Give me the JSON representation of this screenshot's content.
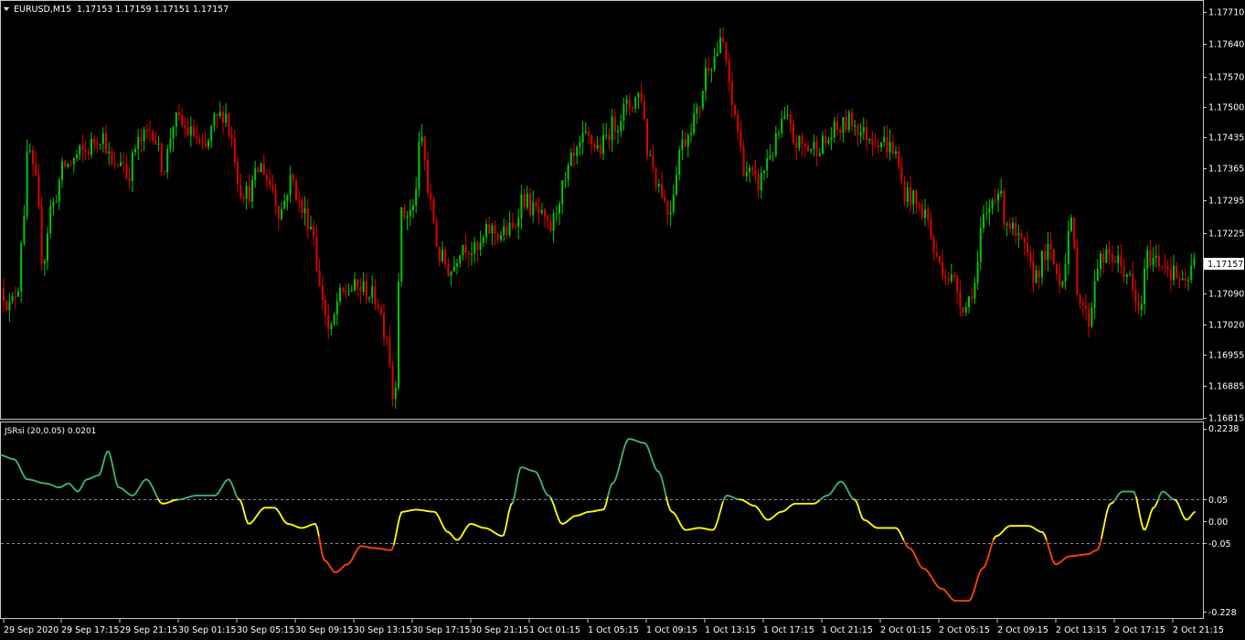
{
  "main_panel": {
    "header_symbol": "EURUSD,M15",
    "header_ohlc": "1.17153 1.17159 1.17151 1.17157",
    "price_ticks": [
      "1.17710",
      "1.17640",
      "1.17570",
      "1.17500",
      "1.17435",
      "1.17365",
      "1.17295",
      "1.17225",
      "1.17090",
      "1.17020",
      "1.16955",
      "1.16885",
      "1.16815"
    ],
    "current_price": "1.17157",
    "price_range": [
      1.16815,
      1.1771
    ],
    "colors": {
      "bull": "#00c800",
      "bear": "#e00000",
      "price_marker_bg": "#ffffff"
    }
  },
  "indicator_panel": {
    "title": "JSRsi (20,0.05) 0.0201",
    "ticks": [
      "0.2238",
      "0.05",
      "0.00",
      "-0.05",
      "-0.228"
    ],
    "levels": [
      0.05,
      -0.05
    ],
    "range": [
      -0.228,
      0.2238
    ],
    "colors": {
      "up": "#3cb371",
      "neutral": "#ffff00",
      "down": "#ff4500",
      "level_line": "#888888"
    }
  },
  "time_axis": [
    "29 Sep 2020",
    "29 Sep 17:15",
    "29 Sep 21:15",
    "30 Sep 01:15",
    "30 Sep 05:15",
    "30 Sep 09:15",
    "30 Sep 13:15",
    "30 Sep 17:15",
    "30 Sep 21:15",
    "1 Oct 01:15",
    "1 Oct 05:15",
    "1 Oct 09:15",
    "1 Oct 13:15",
    "1 Oct 17:15",
    "1 Oct 21:15",
    "2 Oct 01:15",
    "2 Oct 05:15",
    "2 Oct 09:15",
    "2 Oct 13:15",
    "2 Oct 17:15",
    "2 Oct 21:15"
  ],
  "chart_data": {
    "type": "candlestick",
    "symbol": "EURUSD,M15",
    "price_anchors": [
      [
        0,
        1.171
      ],
      [
        10,
        1.1706
      ],
      [
        18,
        1.171
      ],
      [
        25,
        1.1727
      ],
      [
        30,
        1.1741
      ],
      [
        38,
        1.1733
      ],
      [
        46,
        1.1716
      ],
      [
        55,
        1.1728
      ],
      [
        70,
        1.1737
      ],
      [
        90,
        1.174
      ],
      [
        110,
        1.1744
      ],
      [
        124,
        1.1736
      ],
      [
        132,
        1.1739
      ],
      [
        138,
        1.1735
      ],
      [
        150,
        1.1742
      ],
      [
        165,
        1.1745
      ],
      [
        178,
        1.1737
      ],
      [
        190,
        1.1747
      ],
      [
        210,
        1.1744
      ],
      [
        222,
        1.174
      ],
      [
        235,
        1.1747
      ],
      [
        245,
        1.1749
      ],
      [
        252,
        1.1743
      ],
      [
        262,
        1.1732
      ],
      [
        270,
        1.1731
      ],
      [
        285,
        1.1737
      ],
      [
        295,
        1.1733
      ],
      [
        305,
        1.1727
      ],
      [
        318,
        1.1734
      ],
      [
        330,
        1.1727
      ],
      [
        340,
        1.1724
      ],
      [
        350,
        1.1709
      ],
      [
        360,
        1.17
      ],
      [
        370,
        1.1708
      ],
      [
        380,
        1.171
      ],
      [
        395,
        1.171
      ],
      [
        410,
        1.1708
      ],
      [
        422,
        1.17
      ],
      [
        430,
        1.1685
      ],
      [
        438,
        1.1726
      ],
      [
        450,
        1.1727
      ],
      [
        460,
        1.1743
      ],
      [
        470,
        1.1728
      ],
      [
        480,
        1.1717
      ],
      [
        492,
        1.1714
      ],
      [
        505,
        1.172
      ],
      [
        520,
        1.1718
      ],
      [
        535,
        1.1723
      ],
      [
        545,
        1.1722
      ],
      [
        560,
        1.1723
      ],
      [
        570,
        1.173
      ],
      [
        585,
        1.1727
      ],
      [
        600,
        1.1723
      ],
      [
        615,
        1.1732
      ],
      [
        625,
        1.1738
      ],
      [
        640,
        1.1743
      ],
      [
        655,
        1.1741
      ],
      [
        670,
        1.1746
      ],
      [
        685,
        1.175
      ],
      [
        700,
        1.1753
      ],
      [
        708,
        1.174
      ],
      [
        720,
        1.1733
      ],
      [
        730,
        1.1727
      ],
      [
        745,
        1.1742
      ],
      [
        760,
        1.1748
      ],
      [
        775,
        1.176
      ],
      [
        790,
        1.1764
      ],
      [
        800,
        1.175
      ],
      [
        815,
        1.1736
      ],
      [
        828,
        1.1733
      ],
      [
        842,
        1.174
      ],
      [
        858,
        1.1747
      ],
      [
        870,
        1.1742
      ],
      [
        885,
        1.1741
      ],
      [
        900,
        1.1742
      ],
      [
        915,
        1.1745
      ],
      [
        930,
        1.1747
      ],
      [
        945,
        1.1744
      ],
      [
        960,
        1.1743
      ],
      [
        975,
        1.1741
      ],
      [
        990,
        1.1731
      ],
      [
        1010,
        1.1727
      ],
      [
        1025,
        1.1716
      ],
      [
        1040,
        1.1712
      ],
      [
        1055,
        1.1706
      ],
      [
        1065,
        1.1711
      ],
      [
        1075,
        1.1725
      ],
      [
        1090,
        1.1732
      ],
      [
        1100,
        1.1725
      ],
      [
        1115,
        1.172
      ],
      [
        1130,
        1.1713
      ],
      [
        1145,
        1.1718
      ],
      [
        1160,
        1.1712
      ],
      [
        1170,
        1.1724
      ],
      [
        1180,
        1.1708
      ],
      [
        1190,
        1.1703
      ],
      [
        1200,
        1.1716
      ],
      [
        1215,
        1.1717
      ],
      [
        1230,
        1.1714
      ],
      [
        1245,
        1.1705
      ],
      [
        1255,
        1.1717
      ],
      [
        1270,
        1.1716
      ],
      [
        1285,
        1.1713
      ],
      [
        1295,
        1.171
      ],
      [
        1305,
        1.17157
      ]
    ],
    "jsrsi_anchors": [
      [
        0,
        0.16
      ],
      [
        15,
        0.15
      ],
      [
        30,
        0.1
      ],
      [
        50,
        0.09
      ],
      [
        65,
        0.08
      ],
      [
        75,
        0.09
      ],
      [
        85,
        0.07
      ],
      [
        95,
        0.1
      ],
      [
        108,
        0.11
      ],
      [
        118,
        0.17
      ],
      [
        130,
        0.08
      ],
      [
        145,
        0.06
      ],
      [
        160,
        0.1
      ],
      [
        178,
        0.04
      ],
      [
        195,
        0.05
      ],
      [
        215,
        0.06
      ],
      [
        235,
        0.06
      ],
      [
        250,
        0.1
      ],
      [
        262,
        0.05
      ],
      [
        272,
        -0.01
      ],
      [
        290,
        0.03
      ],
      [
        300,
        0.03
      ],
      [
        315,
        -0.01
      ],
      [
        330,
        -0.02
      ],
      [
        345,
        -0.01
      ],
      [
        355,
        -0.1
      ],
      [
        367,
        -0.13
      ],
      [
        380,
        -0.11
      ],
      [
        395,
        -0.065
      ],
      [
        410,
        -0.07
      ],
      [
        428,
        -0.075
      ],
      [
        440,
        0.02
      ],
      [
        455,
        0.025
      ],
      [
        475,
        0.02
      ],
      [
        490,
        -0.03
      ],
      [
        500,
        -0.05
      ],
      [
        515,
        -0.01
      ],
      [
        530,
        -0.02
      ],
      [
        550,
        -0.04
      ],
      [
        560,
        0.04
      ],
      [
        570,
        0.13
      ],
      [
        585,
        0.12
      ],
      [
        600,
        0.06
      ],
      [
        615,
        -0.01
      ],
      [
        630,
        0.01
      ],
      [
        645,
        0.02
      ],
      [
        660,
        0.025
      ],
      [
        670,
        0.09
      ],
      [
        688,
        0.2
      ],
      [
        705,
        0.19
      ],
      [
        720,
        0.12
      ],
      [
        735,
        0.02
      ],
      [
        750,
        -0.025
      ],
      [
        765,
        -0.02
      ],
      [
        780,
        -0.025
      ],
      [
        795,
        0.06
      ],
      [
        810,
        0.05
      ],
      [
        825,
        0.035
      ],
      [
        840,
        0.0
      ],
      [
        855,
        0.02
      ],
      [
        870,
        0.04
      ],
      [
        890,
        0.04
      ],
      [
        905,
        0.06
      ],
      [
        920,
        0.095
      ],
      [
        935,
        0.05
      ],
      [
        945,
        0.0
      ],
      [
        960,
        -0.02
      ],
      [
        980,
        -0.02
      ],
      [
        995,
        -0.07
      ],
      [
        1010,
        -0.12
      ],
      [
        1030,
        -0.17
      ],
      [
        1045,
        -0.2
      ],
      [
        1060,
        -0.2
      ],
      [
        1075,
        -0.12
      ],
      [
        1090,
        -0.04
      ],
      [
        1105,
        -0.015
      ],
      [
        1125,
        -0.015
      ],
      [
        1140,
        -0.03
      ],
      [
        1155,
        -0.11
      ],
      [
        1170,
        -0.09
      ],
      [
        1190,
        -0.085
      ],
      [
        1200,
        -0.075
      ],
      [
        1215,
        0.04
      ],
      [
        1228,
        0.07
      ],
      [
        1240,
        0.07
      ],
      [
        1252,
        -0.025
      ],
      [
        1262,
        0.03
      ],
      [
        1272,
        0.07
      ],
      [
        1285,
        0.05
      ],
      [
        1298,
        0.0
      ],
      [
        1308,
        0.0201
      ]
    ]
  }
}
